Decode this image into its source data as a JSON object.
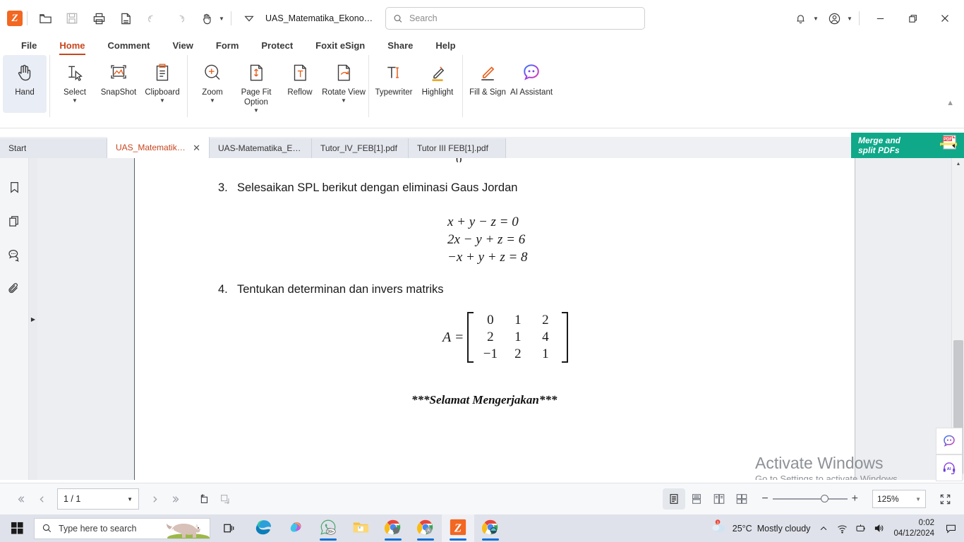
{
  "titlebar": {
    "app_logo": "foxit-logo-icon",
    "document_name": "UAS_Matematika_Ekonomi_...",
    "search_placeholder": "Search",
    "search_value": "",
    "tools": [
      {
        "name": "open-file-icon",
        "title": "Open"
      },
      {
        "name": "save-icon",
        "title": "Save"
      },
      {
        "name": "print-icon",
        "title": "Print"
      },
      {
        "name": "export-pdf-icon",
        "title": "Export"
      },
      {
        "name": "undo-icon",
        "title": "Undo"
      },
      {
        "name": "redo-icon",
        "title": "Redo"
      },
      {
        "name": "hand-tool-icon",
        "title": "Hand Tool"
      }
    ],
    "notification_icon": "bell-icon",
    "account_icon": "account-icon",
    "minimize": "minimize-icon",
    "restore": "restore-icon",
    "close": "close-icon"
  },
  "menubar": {
    "items": [
      {
        "label": "File",
        "active": false
      },
      {
        "label": "Home",
        "active": true
      },
      {
        "label": "Comment",
        "active": false
      },
      {
        "label": "View",
        "active": false
      },
      {
        "label": "Form",
        "active": false
      },
      {
        "label": "Protect",
        "active": false
      },
      {
        "label": "Foxit eSign",
        "active": false
      },
      {
        "label": "Share",
        "active": false
      },
      {
        "label": "Help",
        "active": false
      }
    ]
  },
  "ribbon": {
    "groups": [
      {
        "buttons": [
          {
            "label": "Hand",
            "icon": "hand-icon",
            "caret": false,
            "selected": true
          }
        ]
      },
      {
        "buttons": [
          {
            "label": "Select",
            "icon": "select-icon",
            "caret": true,
            "selected": false
          },
          {
            "label": "SnapShot",
            "icon": "snapshot-icon",
            "caret": false,
            "selected": false
          },
          {
            "label": "Clipboard",
            "icon": "clipboard-icon",
            "caret": true,
            "selected": false
          }
        ]
      },
      {
        "buttons": [
          {
            "label": "Zoom",
            "icon": "zoom-in-icon",
            "caret": true,
            "selected": false
          },
          {
            "label": "Page Fit Option",
            "icon": "page-fit-icon",
            "caret": true,
            "selected": false
          },
          {
            "label": "Reflow",
            "icon": "reflow-icon",
            "caret": false,
            "selected": false
          },
          {
            "label": "Rotate View",
            "icon": "rotate-view-icon",
            "caret": true,
            "selected": false
          }
        ]
      },
      {
        "buttons": [
          {
            "label": "Typewriter",
            "icon": "typewriter-icon",
            "caret": false,
            "selected": false
          },
          {
            "label": "Highlight",
            "icon": "highlight-icon",
            "caret": false,
            "selected": false
          }
        ]
      },
      {
        "buttons": [
          {
            "label": "Fill & Sign",
            "icon": "fill-and-sign-icon",
            "caret": false,
            "selected": false
          },
          {
            "label": "AI Assistant",
            "icon": "ai-assistant-icon",
            "caret": false,
            "selected": false
          }
        ]
      }
    ],
    "collapse_icon": "chevron-up-icon"
  },
  "tabbar": {
    "tabs": [
      {
        "label": "Start",
        "active": false,
        "closable": false
      },
      {
        "label": "UAS_Matematika_Ek...",
        "active": true,
        "closable": true
      },
      {
        "label": "UAS-Matematika_Ekono...",
        "active": false,
        "closable": false
      },
      {
        "label": "Tutor_IV_FEB[1].pdf",
        "active": false,
        "closable": false
      },
      {
        "label": "Tutor III FEB[1].pdf",
        "active": false,
        "closable": false
      }
    ],
    "overflow_icon": "chevron-down-icon",
    "promo": {
      "line1": "Merge and",
      "line2": "split PDFs",
      "icon": "pdf-merge-icon",
      "color": "#0FA889"
    }
  },
  "leftpanel": {
    "items": [
      {
        "name": "bookmark-icon",
        "label": "Bookmarks"
      },
      {
        "name": "pages-icon",
        "label": "Page Thumbnails"
      },
      {
        "name": "comments-icon",
        "label": "Comments"
      },
      {
        "name": "attachments-icon",
        "label": "Attachments"
      }
    ],
    "expand_icon": "chevron-right-icon"
  },
  "document": {
    "clipped_top_text": "0",
    "questions": [
      {
        "number": "3.",
        "text": "Selesaikan SPL berikut dengan eliminasi Gaus Jordan",
        "equations": [
          "x + y − z = 0",
          "2x − y + z = 6",
          "−x + y + z = 8"
        ]
      },
      {
        "number": "4.",
        "text": "Tentukan determinan dan invers matriks",
        "matrix_label": "A =",
        "matrix": [
          [
            "0",
            "1",
            "2"
          ],
          [
            "2",
            "1",
            "4"
          ],
          [
            "−1",
            "2",
            "1"
          ]
        ]
      }
    ],
    "closing_text": "***Selamat Mengerjakan***"
  },
  "activation_watermark": {
    "line1": "Activate Windows",
    "line2": "Go to Settings to activate Windows."
  },
  "ai_dock": [
    {
      "name": "ai-chat-icon",
      "label": "AI Assistant"
    },
    {
      "name": "ai-support-headset-icon",
      "label": "AI Support"
    }
  ],
  "statusbar": {
    "first_page_icon": "first-page-icon",
    "prev_page_icon": "prev-page-icon",
    "page_value": "1 / 1",
    "page_caret": "chevron-down-icon",
    "next_page_icon": "next-page-icon",
    "last_page_icon": "last-page-icon",
    "rotate_left_icon": "rotate-left-icon",
    "rotate_right_icon": "rotate-right-icon",
    "view_modes": [
      {
        "name": "single-page-view-icon",
        "active": true
      },
      {
        "name": "continuous-scroll-view-icon",
        "active": false
      },
      {
        "name": "two-page-view-icon",
        "active": false
      },
      {
        "name": "two-page-scroll-view-icon",
        "active": false
      }
    ],
    "zoom_out_label": "−",
    "zoom_in_label": "+",
    "zoom_value": "125%",
    "zoom_caret": "chevron-down-icon",
    "fullscreen_icon": "fullscreen-icon"
  },
  "taskbar": {
    "start_icon": "windows-start-icon",
    "search_icon": "search-icon",
    "search_placeholder": "Type here to search",
    "search_decoration": "rhino-image",
    "task_view_icon": "task-view-icon",
    "apps": [
      {
        "name": "edge-icon",
        "label": "Microsoft Edge",
        "running": false,
        "active": false
      },
      {
        "name": "copilot-icon",
        "label": "Copilot",
        "running": false,
        "active": false
      },
      {
        "name": "whatsapp-icon",
        "label": "WhatsApp",
        "running": true,
        "active": false,
        "badge": "99+"
      },
      {
        "name": "file-explorer-icon",
        "label": "File Explorer",
        "running": false,
        "active": false
      },
      {
        "name": "chrome-icon",
        "label": "Google Chrome",
        "running": true,
        "active": false
      },
      {
        "name": "chrome-icon",
        "label": "Google Chrome",
        "running": true,
        "active": false
      },
      {
        "name": "foxit-reader-icon",
        "label": "Foxit PDF Reader",
        "running": true,
        "active": true
      },
      {
        "name": "chrome-icon",
        "label": "Google Chrome",
        "running": true,
        "active": false
      }
    ],
    "weather": {
      "icon": "partly-sunny-icon",
      "temperature": "25°C",
      "condition": "Mostly cloudy",
      "badge": "1"
    },
    "tray": [
      {
        "name": "show-hidden-icons-icon"
      },
      {
        "name": "wifi-icon"
      },
      {
        "name": "battery-icon"
      },
      {
        "name": "volume-icon"
      }
    ],
    "clock": {
      "time": "0:02",
      "date": "04/12/2024"
    },
    "notification_icon": "action-center-icon"
  }
}
